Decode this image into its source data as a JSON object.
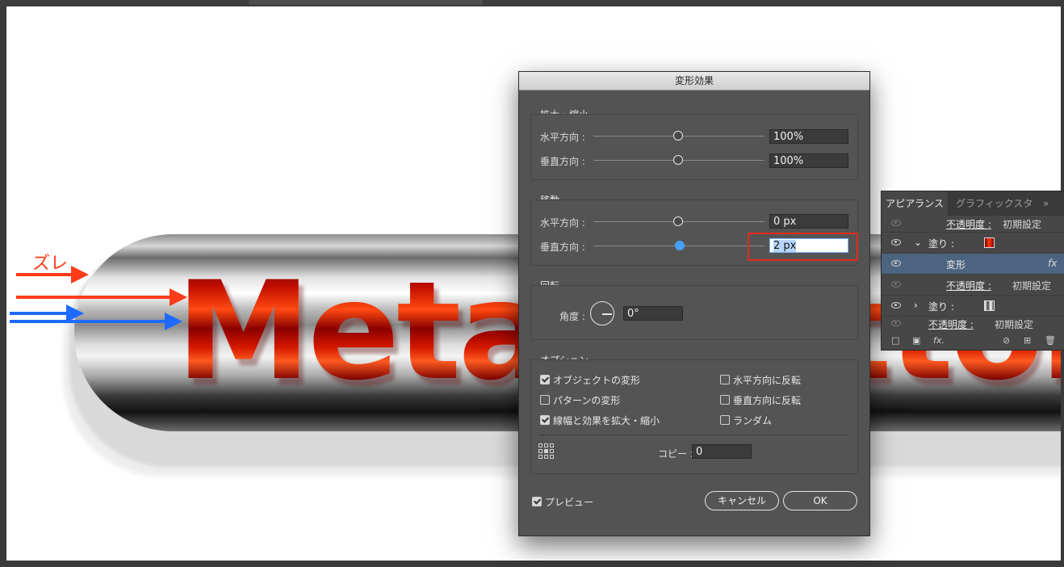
{
  "artwork": {
    "annotation_label": "ズレ",
    "headline_text": "Metal Button",
    "colors": {
      "red_arrow": "#ff3b1a",
      "blue_arrow": "#1f6bff",
      "highlight_box": "#e52a1a"
    }
  },
  "dialog": {
    "title": "変形効果",
    "scale": {
      "label": "拡大・縮小",
      "horizontal_label": "水平方向 :",
      "horizontal_value": "100%",
      "vertical_label": "垂直方向 :",
      "vertical_value": "100%"
    },
    "move": {
      "label": "移動",
      "horizontal_label": "水平方向 :",
      "horizontal_value": "0 px",
      "vertical_label": "垂直方向 :",
      "vertical_value": "2 px"
    },
    "rotate": {
      "label": "回転",
      "angle_label": "角度 :",
      "angle_value": "0°"
    },
    "options": {
      "label": "オプション",
      "transform_objects": {
        "label": "オブジェクトの変形",
        "checked": true
      },
      "transform_patterns": {
        "label": "パターンの変形",
        "checked": false
      },
      "scale_strokes": {
        "label": "線幅と効果を拡大・縮小",
        "checked": true
      },
      "reflect_x": {
        "label": "水平方向に反転",
        "checked": false
      },
      "reflect_y": {
        "label": "垂直方向に反転",
        "checked": false
      },
      "random": {
        "label": "ランダム",
        "checked": false
      },
      "copies_label": "コピー :",
      "copies_value": "0"
    },
    "preview": {
      "label": "プレビュー",
      "checked": true
    },
    "cancel_label": "キャンセル",
    "ok_label": "OK"
  },
  "appearance_panel": {
    "tabs": [
      "アピアランス",
      "グラフィックスタ"
    ],
    "more_glyph": "»",
    "rows": [
      {
        "name": "不透明度 :",
        "value": "初期設定"
      },
      {
        "name": "塗り :",
        "swatch": "red"
      },
      {
        "name": "変形",
        "fx": "fx"
      },
      {
        "name": "不透明度 :",
        "value": "初期設定"
      },
      {
        "name": "塗り :",
        "swatch": "gray"
      },
      {
        "name": "不透明度 :",
        "value": "初期設定"
      }
    ],
    "footer_fx": "fx."
  }
}
